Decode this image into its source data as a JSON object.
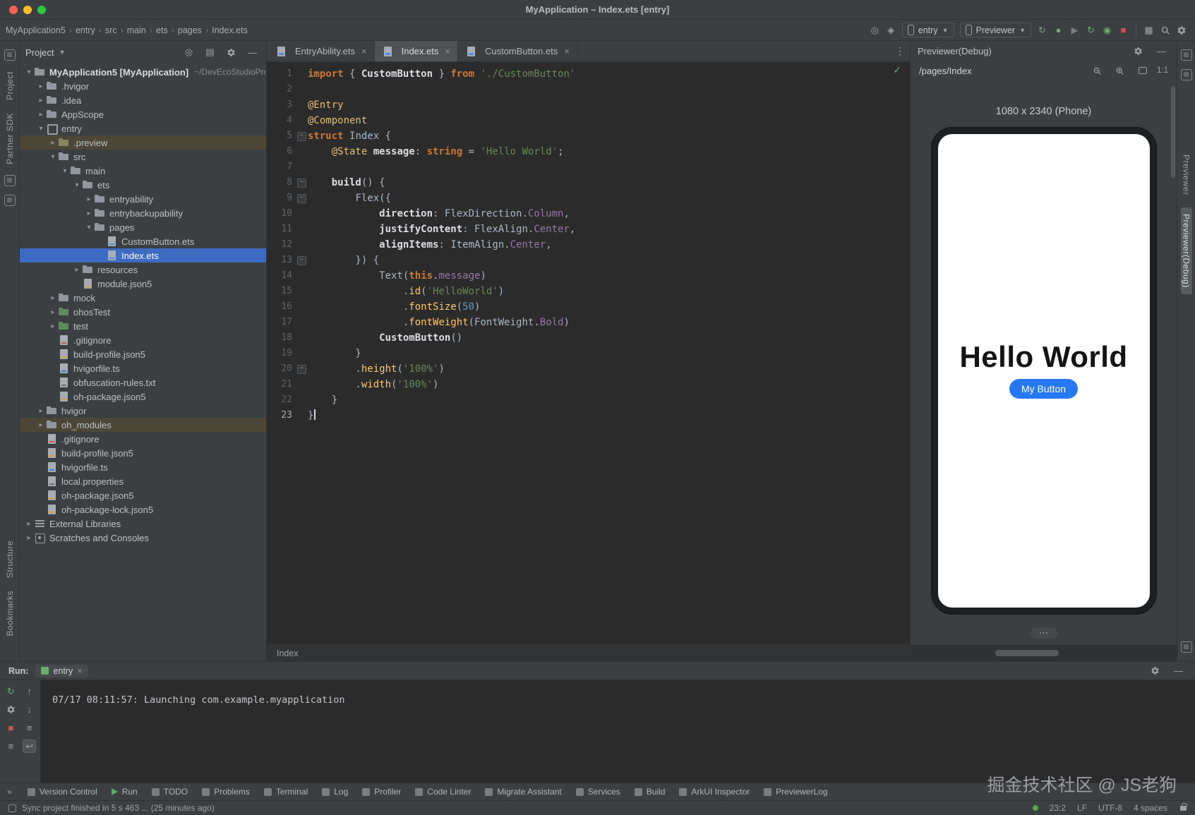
{
  "titlebar": {
    "title": "MyApplication – Index.ets [entry]"
  },
  "toolbar": {
    "breadcrumbs": [
      "MyApplication5",
      "entry",
      "src",
      "main",
      "ets",
      "pages",
      "Index.ets"
    ],
    "device_combo": "entry",
    "previewer_combo": "Previewer",
    "run_icons": [
      "sync-app-icon",
      "debug-app-icon",
      "run-disabled-icon",
      "rerun-icon",
      "debug-attach-icon",
      "stop-icon"
    ]
  },
  "left_strip": {
    "top": [
      "Project",
      "Partner SDK"
    ],
    "bottom": [
      "Structure",
      "Bookmarks"
    ]
  },
  "right_strip": {
    "labels": [
      {
        "label": "Previewer",
        "active": false
      },
      {
        "label": "Previewer(Debug)",
        "active": true
      }
    ]
  },
  "project": {
    "title": "Project",
    "tree": [
      {
        "label": "MyApplication5 [MyApplication]",
        "suffix": "~/DevEcoStudioPro",
        "indent": 0,
        "icon": "folder",
        "chevron": "open",
        "bold": true
      },
      {
        "label": ".hvigor",
        "indent": 1,
        "icon": "folder",
        "chevron": "closed"
      },
      {
        "label": ".idea",
        "indent": 1,
        "icon": "folder",
        "chevron": "closed"
      },
      {
        "label": "AppScope",
        "indent": 1,
        "icon": "folder",
        "chevron": "closed"
      },
      {
        "label": "entry",
        "indent": 1,
        "icon": "module",
        "chevron": "open"
      },
      {
        "label": ".preview",
        "indent": 2,
        "icon": "folder-ex",
        "chevron": "closed",
        "bg": "excluded"
      },
      {
        "label": "src",
        "indent": 2,
        "icon": "folder",
        "chevron": "open"
      },
      {
        "label": "main",
        "indent": 3,
        "icon": "folder",
        "chevron": "open"
      },
      {
        "label": "ets",
        "indent": 4,
        "icon": "folder",
        "chevron": "open"
      },
      {
        "label": "entryability",
        "indent": 5,
        "icon": "folder",
        "chevron": "closed"
      },
      {
        "label": "entrybackupability",
        "indent": 5,
        "icon": "folder",
        "chevron": "closed"
      },
      {
        "label": "pages",
        "indent": 5,
        "icon": "folder",
        "chevron": "open"
      },
      {
        "label": "CustomButton.ets",
        "indent": 6,
        "icon": "file-ets"
      },
      {
        "label": "Index.ets",
        "indent": 6,
        "icon": "file-ets",
        "selected": true
      },
      {
        "label": "resources",
        "indent": 4,
        "icon": "folder",
        "chevron": "closed"
      },
      {
        "label": "module.json5",
        "indent": 4,
        "icon": "file-json"
      },
      {
        "label": "mock",
        "indent": 2,
        "icon": "folder",
        "chevron": "closed"
      },
      {
        "label": "ohosTest",
        "indent": 2,
        "icon": "folder-test",
        "chevron": "closed"
      },
      {
        "label": "test",
        "indent": 2,
        "icon": "folder-test",
        "chevron": "closed"
      },
      {
        "label": ".gitignore",
        "indent": 2,
        "icon": "file-git"
      },
      {
        "label": "build-profile.json5",
        "indent": 2,
        "icon": "file-json"
      },
      {
        "label": "hvigorfile.ts",
        "indent": 2,
        "icon": "file-ts"
      },
      {
        "label": "obfuscation-rules.txt",
        "indent": 2,
        "icon": "file-txt"
      },
      {
        "label": "oh-package.json5",
        "indent": 2,
        "icon": "file-json"
      },
      {
        "label": "hvigor",
        "indent": 1,
        "icon": "folder",
        "chevron": "closed"
      },
      {
        "label": "oh_modules",
        "indent": 1,
        "icon": "folder",
        "chevron": "closed",
        "bg": "excluded"
      },
      {
        "label": ".gitignore",
        "indent": 1,
        "icon": "file-git"
      },
      {
        "label": "build-profile.json5",
        "indent": 1,
        "icon": "file-json"
      },
      {
        "label": "hvigorfile.ts",
        "indent": 1,
        "icon": "file-ts"
      },
      {
        "label": "local.properties",
        "indent": 1,
        "icon": "file-props"
      },
      {
        "label": "oh-package.json5",
        "indent": 1,
        "icon": "file-json"
      },
      {
        "label": "oh-package-lock.json5",
        "indent": 1,
        "icon": "file-json"
      },
      {
        "label": "External Libraries",
        "indent": 0,
        "icon": "lib",
        "chevron": "closed"
      },
      {
        "label": "Scratches and Consoles",
        "indent": 0,
        "icon": "scratch",
        "chevron": "closed"
      }
    ]
  },
  "editor": {
    "tabs": [
      {
        "label": "EntryAbility.ets",
        "active": false
      },
      {
        "label": "Index.ets",
        "active": true
      },
      {
        "label": "CustomButton.ets",
        "active": false
      }
    ],
    "breadcrumb": "Index",
    "lines": [
      {
        "n": 1,
        "t": [
          [
            "kw",
            "import"
          ],
          [
            "pl",
            " { "
          ],
          [
            "prop",
            "CustomButton"
          ],
          [
            "pl",
            " } "
          ],
          [
            "kw",
            "from"
          ],
          [
            "pl",
            " "
          ],
          [
            "str",
            "'./CustomButton'"
          ]
        ]
      },
      {
        "n": 2,
        "t": []
      },
      {
        "n": 3,
        "t": [
          [
            "deco",
            "@Entry"
          ]
        ]
      },
      {
        "n": 4,
        "t": [
          [
            "deco",
            "@Component"
          ]
        ]
      },
      {
        "n": 5,
        "fold": true,
        "t": [
          [
            "kw",
            "struct"
          ],
          [
            "pl",
            " "
          ],
          [
            "typ",
            "Index"
          ],
          [
            "pl",
            " {"
          ]
        ]
      },
      {
        "n": 6,
        "t": [
          [
            "pl",
            "    "
          ],
          [
            "deco",
            "@State"
          ],
          [
            "pl",
            " "
          ],
          [
            "prop",
            "message"
          ],
          [
            "pl",
            ": "
          ],
          [
            "kw",
            "string"
          ],
          [
            "pl",
            " = "
          ],
          [
            "str",
            "'Hello World'"
          ],
          [
            "pl",
            ";"
          ]
        ]
      },
      {
        "n": 7,
        "t": []
      },
      {
        "n": 8,
        "fold": true,
        "t": [
          [
            "pl",
            "    "
          ],
          [
            "prop",
            "build"
          ],
          [
            "pl",
            "() {"
          ]
        ]
      },
      {
        "n": 9,
        "fold": true,
        "t": [
          [
            "pl",
            "        "
          ],
          [
            "pl",
            "Flex({"
          ]
        ]
      },
      {
        "n": 10,
        "t": [
          [
            "pl",
            "            "
          ],
          [
            "prop",
            "direction"
          ],
          [
            "pl",
            ": "
          ],
          [
            "pl",
            "FlexDirection"
          ],
          [
            "pl",
            "."
          ],
          [
            "mem",
            "Column"
          ],
          [
            "pl",
            ","
          ]
        ]
      },
      {
        "n": 11,
        "t": [
          [
            "pl",
            "            "
          ],
          [
            "prop",
            "justifyContent"
          ],
          [
            "pl",
            ": "
          ],
          [
            "pl",
            "FlexAlign"
          ],
          [
            "pl",
            "."
          ],
          [
            "mem",
            "Center"
          ],
          [
            "pl",
            ","
          ]
        ]
      },
      {
        "n": 12,
        "t": [
          [
            "pl",
            "            "
          ],
          [
            "prop",
            "alignItems"
          ],
          [
            "pl",
            ": "
          ],
          [
            "pl",
            "ItemAlign"
          ],
          [
            "pl",
            "."
          ],
          [
            "mem",
            "Center"
          ],
          [
            "pl",
            ","
          ]
        ]
      },
      {
        "n": 13,
        "fold": true,
        "t": [
          [
            "pl",
            "        }) {"
          ]
        ]
      },
      {
        "n": 14,
        "t": [
          [
            "pl",
            "            "
          ],
          [
            "pl",
            "Text("
          ],
          [
            "kw",
            "this"
          ],
          [
            "pl",
            "."
          ],
          [
            "mem",
            "message"
          ],
          [
            "pl",
            ")"
          ]
        ]
      },
      {
        "n": 15,
        "t": [
          [
            "pl",
            "                ."
          ],
          [
            "fn",
            "id"
          ],
          [
            "pl",
            "("
          ],
          [
            "str",
            "'HelloWorld'"
          ],
          [
            "pl",
            ")"
          ]
        ]
      },
      {
        "n": 16,
        "t": [
          [
            "pl",
            "                ."
          ],
          [
            "fn",
            "fontSize"
          ],
          [
            "pl",
            "("
          ],
          [
            "num",
            "50"
          ],
          [
            "pl",
            ")"
          ]
        ]
      },
      {
        "n": 17,
        "t": [
          [
            "pl",
            "                ."
          ],
          [
            "fn",
            "fontWeight"
          ],
          [
            "pl",
            "("
          ],
          [
            "pl",
            "FontWeight"
          ],
          [
            "pl",
            "."
          ],
          [
            "mem",
            "Bold"
          ],
          [
            "pl",
            ")"
          ]
        ]
      },
      {
        "n": 18,
        "t": [
          [
            "pl",
            "            "
          ],
          [
            "prop",
            "CustomButton"
          ],
          [
            "pl",
            "()"
          ]
        ]
      },
      {
        "n": 19,
        "t": [
          [
            "pl",
            "        }"
          ]
        ]
      },
      {
        "n": 20,
        "fold": true,
        "t": [
          [
            "pl",
            "        ."
          ],
          [
            "fn",
            "height"
          ],
          [
            "pl",
            "("
          ],
          [
            "str",
            "'100%'"
          ],
          [
            "pl",
            ")"
          ]
        ]
      },
      {
        "n": 21,
        "t": [
          [
            "pl",
            "        ."
          ],
          [
            "fn",
            "width"
          ],
          [
            "pl",
            "("
          ],
          [
            "str",
            "'100%'"
          ],
          [
            "pl",
            ")"
          ]
        ]
      },
      {
        "n": 22,
        "t": [
          [
            "pl",
            "    }"
          ]
        ]
      },
      {
        "n": 23,
        "caret": true,
        "t": [
          [
            "pl",
            "}"
          ]
        ]
      }
    ]
  },
  "previewer": {
    "title": "Previewer(Debug)",
    "route": "/pages/Index",
    "zoom_label": "1:1",
    "device_label": "1080 x 2340 (Phone)",
    "screen_text": "Hello World",
    "button_label": "My Button",
    "more_label": "⋯"
  },
  "run": {
    "label": "Run:",
    "tab": "entry",
    "console": "07/17 08:11:57: Launching com.example.myapplication"
  },
  "bottom_bar": [
    "Version Control",
    "Run",
    "TODO",
    "Problems",
    "Terminal",
    "Log",
    "Profiler",
    "Code Linter",
    "Migrate Assistant",
    "Services",
    "Build",
    "ArkUI Inspector",
    "PreviewerLog"
  ],
  "status_bar": {
    "left": "Sync project finished in 5 s 463 ... (25 minutes ago)",
    "right": [
      "23:2",
      "LF",
      "UTF-8",
      "4 spaces"
    ]
  },
  "watermark": "掘金技术社区 @ JS老狗",
  "colors": {
    "selection_blue": "#3d6bc2",
    "button_blue": "#2678f3",
    "run_green": "#6aab73",
    "stop_red": "#c75450"
  }
}
